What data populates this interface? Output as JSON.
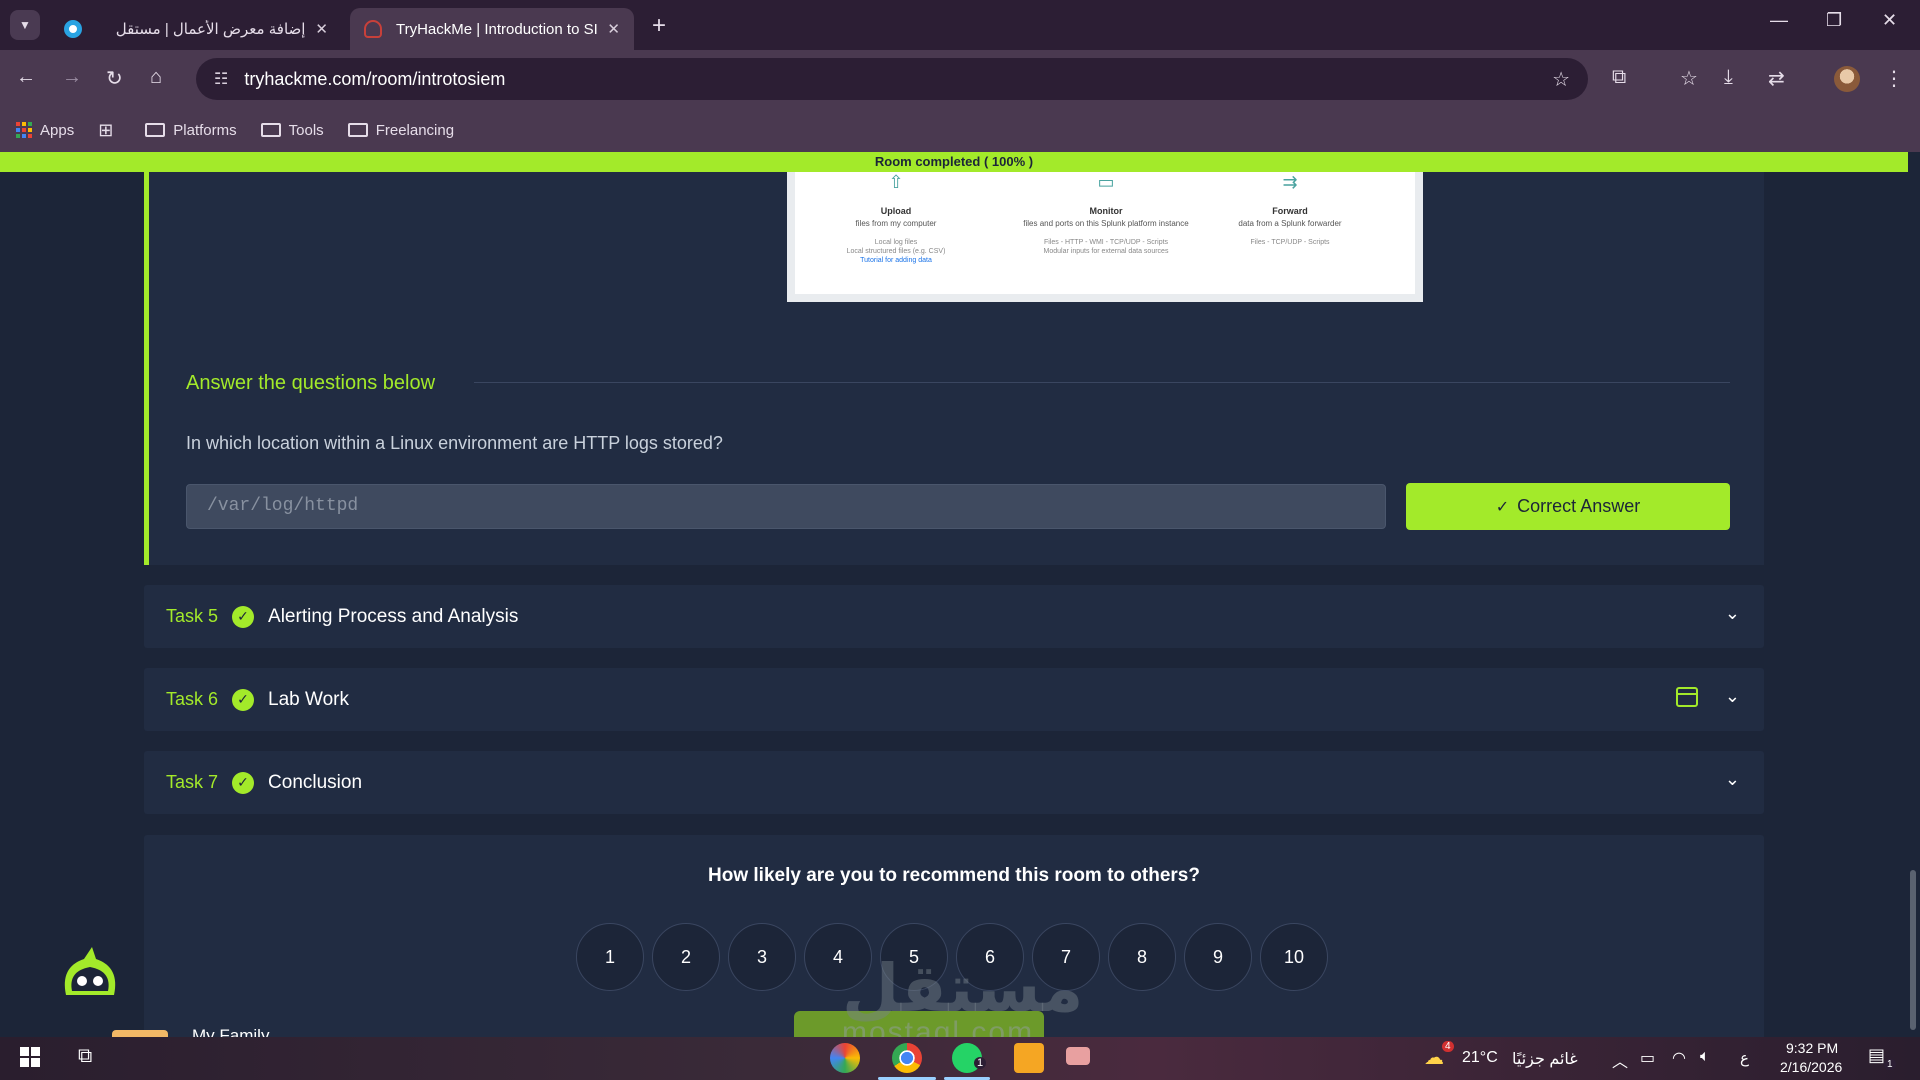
{
  "browser": {
    "tabs": [
      {
        "label": "إضافة معرض الأعمال | مستقل",
        "close": "✕"
      },
      {
        "label": "TryHackMe | Introduction to SIE",
        "close": "✕"
      }
    ],
    "new_tab": "+",
    "url": "tryhackme.com/room/introtosiem",
    "bookmarks": [
      {
        "label": "Apps"
      },
      {
        "label": "Platforms"
      },
      {
        "label": "Tools"
      },
      {
        "label": "Freelancing"
      }
    ]
  },
  "page": {
    "progress_text": "Room completed ( 100% )",
    "progress_percent": 100,
    "splunk_options": [
      {
        "title": "Upload",
        "subtitle": "files from my computer",
        "details": [
          "Local log files",
          "Local structured files (e.g. CSV)"
        ],
        "link": "Tutorial for adding data"
      },
      {
        "title": "Monitor",
        "subtitle": "files and ports on this Splunk platform instance",
        "details": [
          "Files - HTTP - WMI - TCP/UDP - Scripts",
          "Modular inputs for external data sources"
        ],
        "link": ""
      },
      {
        "title": "Forward",
        "subtitle": "data from a Splunk forwarder",
        "details": [
          "Files - TCP/UDP - Scripts"
        ],
        "link": ""
      }
    ],
    "answer_heading": "Answer the questions below",
    "question": "In which location within a Linux environment are HTTP logs stored?",
    "answer_value": "/var/log/httpd",
    "correct_label": "Correct Answer",
    "tasks": [
      {
        "num": "Task 5",
        "title": "Alerting Process and Analysis"
      },
      {
        "num": "Task 6",
        "title": "Lab Work"
      },
      {
        "num": "Task 7",
        "title": "Conclusion"
      }
    ],
    "feedback_question": "How likely are you to recommend this room to others?",
    "ratings": [
      "1",
      "2",
      "3",
      "4",
      "5",
      "6",
      "7",
      "8",
      "9",
      "10"
    ],
    "snippet_name": "My Family",
    "watermark": "مستقل",
    "watermark_sub": "mostaql.com"
  },
  "taskbar": {
    "weather_temp": "21°C",
    "weather_text": "غائم جزئيًا",
    "weather_badge": "4",
    "lang": "ع",
    "time": "9:32 PM",
    "date": "2/16/2026",
    "notif_count": "1",
    "whatsapp_badge": "1"
  },
  "colors": {
    "accent": "#a3ea2a",
    "panel": "#212c42",
    "background": "#1c2538",
    "browser_frame": "#4a3950"
  }
}
